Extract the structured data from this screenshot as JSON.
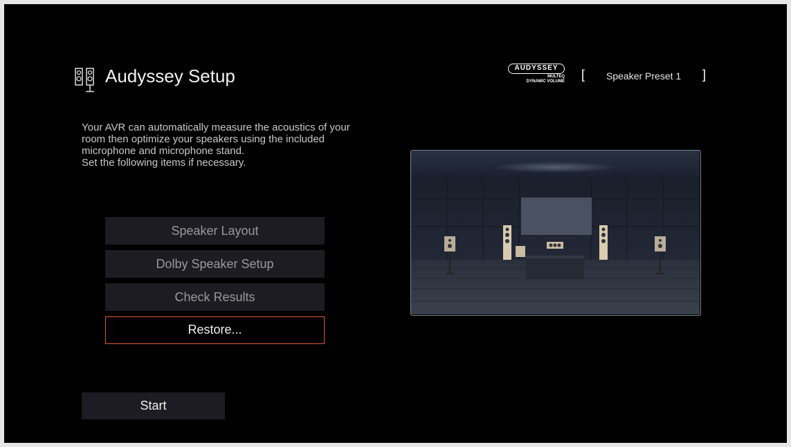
{
  "header": {
    "title": "Audyssey Setup",
    "title_icon": "speakers-icon",
    "logo": {
      "brand": "AUDYSSEY",
      "line1": "MULTEQ",
      "line2": "DYNAMIC VOLUME"
    },
    "preset": {
      "bracket_left": "[",
      "label": "Speaker Preset 1",
      "bracket_right": "]"
    }
  },
  "description": {
    "lines": [
      "Your AVR can automatically measure the acoustics of your",
      "room then optimize your speakers using the included",
      "microphone and microphone stand.",
      "Set the following items if necessary."
    ]
  },
  "menu": {
    "items": [
      {
        "label": "Speaker Layout",
        "focused": false
      },
      {
        "label": "Dolby Speaker Setup",
        "focused": false
      },
      {
        "label": "Check Results",
        "focused": false
      },
      {
        "label": "Restore...",
        "focused": true
      }
    ]
  },
  "start": {
    "label": "Start"
  },
  "illustration": {
    "name": "home-theater-room-image"
  },
  "colors": {
    "background": "#000000",
    "button": "#1c1c22",
    "focus_border": "#e4553a",
    "text_primary": "#f2f2f2",
    "text_muted": "#9a9a9a"
  }
}
